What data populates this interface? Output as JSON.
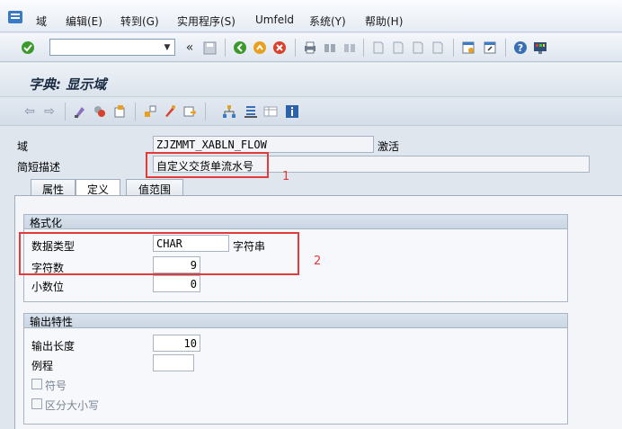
{
  "menu": {
    "items": [
      "域",
      "编辑(E)",
      "转到(G)",
      "实用程序(S)",
      "Umfeld",
      "系统(Y)",
      "帮助(H)"
    ]
  },
  "title": "字典: 显示域",
  "form": {
    "domain_label": "域",
    "domain_value": "ZJZMMT_XABLN_FLOW",
    "status": "激活",
    "short_desc_label": "简短描述",
    "short_desc_value": "自定义交货单流水号"
  },
  "tabs": [
    "属性",
    "定义",
    "值范围"
  ],
  "active_tab": "定义",
  "format_group": {
    "title": "格式化",
    "datatype_label": "数据类型",
    "datatype_value": "CHAR",
    "datatype_desc": "字符串",
    "chars_label": "字符数",
    "chars_value": "9",
    "decimals_label": "小数位",
    "decimals_value": "0"
  },
  "output_group": {
    "title": "输出特性",
    "outlen_label": "输出长度",
    "outlen_value": "10",
    "routine_label": "例程",
    "routine_value": "",
    "sign_label": "符号",
    "lowercase_label": "区分大小写"
  },
  "annotations": [
    "1",
    "2"
  ]
}
